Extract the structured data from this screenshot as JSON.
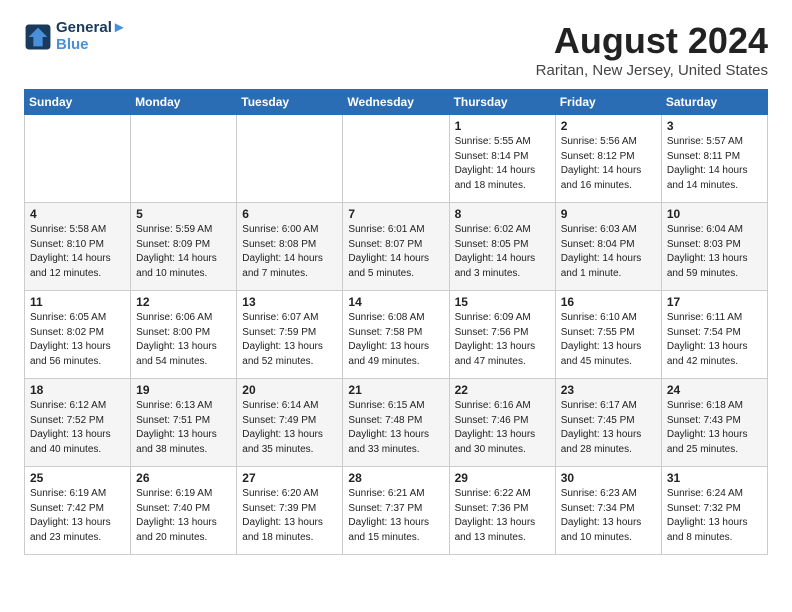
{
  "header": {
    "logo_line1": "General",
    "logo_line2": "Blue",
    "month": "August 2024",
    "location": "Raritan, New Jersey, United States"
  },
  "weekdays": [
    "Sunday",
    "Monday",
    "Tuesday",
    "Wednesday",
    "Thursday",
    "Friday",
    "Saturday"
  ],
  "weeks": [
    [
      {
        "day": "",
        "sunrise": "",
        "sunset": "",
        "daylight": ""
      },
      {
        "day": "",
        "sunrise": "",
        "sunset": "",
        "daylight": ""
      },
      {
        "day": "",
        "sunrise": "",
        "sunset": "",
        "daylight": ""
      },
      {
        "day": "",
        "sunrise": "",
        "sunset": "",
        "daylight": ""
      },
      {
        "day": "1",
        "sunrise": "Sunrise: 5:55 AM",
        "sunset": "Sunset: 8:14 PM",
        "daylight": "Daylight: 14 hours and 18 minutes."
      },
      {
        "day": "2",
        "sunrise": "Sunrise: 5:56 AM",
        "sunset": "Sunset: 8:12 PM",
        "daylight": "Daylight: 14 hours and 16 minutes."
      },
      {
        "day": "3",
        "sunrise": "Sunrise: 5:57 AM",
        "sunset": "Sunset: 8:11 PM",
        "daylight": "Daylight: 14 hours and 14 minutes."
      }
    ],
    [
      {
        "day": "4",
        "sunrise": "Sunrise: 5:58 AM",
        "sunset": "Sunset: 8:10 PM",
        "daylight": "Daylight: 14 hours and 12 minutes."
      },
      {
        "day": "5",
        "sunrise": "Sunrise: 5:59 AM",
        "sunset": "Sunset: 8:09 PM",
        "daylight": "Daylight: 14 hours and 10 minutes."
      },
      {
        "day": "6",
        "sunrise": "Sunrise: 6:00 AM",
        "sunset": "Sunset: 8:08 PM",
        "daylight": "Daylight: 14 hours and 7 minutes."
      },
      {
        "day": "7",
        "sunrise": "Sunrise: 6:01 AM",
        "sunset": "Sunset: 8:07 PM",
        "daylight": "Daylight: 14 hours and 5 minutes."
      },
      {
        "day": "8",
        "sunrise": "Sunrise: 6:02 AM",
        "sunset": "Sunset: 8:05 PM",
        "daylight": "Daylight: 14 hours and 3 minutes."
      },
      {
        "day": "9",
        "sunrise": "Sunrise: 6:03 AM",
        "sunset": "Sunset: 8:04 PM",
        "daylight": "Daylight: 14 hours and 1 minute."
      },
      {
        "day": "10",
        "sunrise": "Sunrise: 6:04 AM",
        "sunset": "Sunset: 8:03 PM",
        "daylight": "Daylight: 13 hours and 59 minutes."
      }
    ],
    [
      {
        "day": "11",
        "sunrise": "Sunrise: 6:05 AM",
        "sunset": "Sunset: 8:02 PM",
        "daylight": "Daylight: 13 hours and 56 minutes."
      },
      {
        "day": "12",
        "sunrise": "Sunrise: 6:06 AM",
        "sunset": "Sunset: 8:00 PM",
        "daylight": "Daylight: 13 hours and 54 minutes."
      },
      {
        "day": "13",
        "sunrise": "Sunrise: 6:07 AM",
        "sunset": "Sunset: 7:59 PM",
        "daylight": "Daylight: 13 hours and 52 minutes."
      },
      {
        "day": "14",
        "sunrise": "Sunrise: 6:08 AM",
        "sunset": "Sunset: 7:58 PM",
        "daylight": "Daylight: 13 hours and 49 minutes."
      },
      {
        "day": "15",
        "sunrise": "Sunrise: 6:09 AM",
        "sunset": "Sunset: 7:56 PM",
        "daylight": "Daylight: 13 hours and 47 minutes."
      },
      {
        "day": "16",
        "sunrise": "Sunrise: 6:10 AM",
        "sunset": "Sunset: 7:55 PM",
        "daylight": "Daylight: 13 hours and 45 minutes."
      },
      {
        "day": "17",
        "sunrise": "Sunrise: 6:11 AM",
        "sunset": "Sunset: 7:54 PM",
        "daylight": "Daylight: 13 hours and 42 minutes."
      }
    ],
    [
      {
        "day": "18",
        "sunrise": "Sunrise: 6:12 AM",
        "sunset": "Sunset: 7:52 PM",
        "daylight": "Daylight: 13 hours and 40 minutes."
      },
      {
        "day": "19",
        "sunrise": "Sunrise: 6:13 AM",
        "sunset": "Sunset: 7:51 PM",
        "daylight": "Daylight: 13 hours and 38 minutes."
      },
      {
        "day": "20",
        "sunrise": "Sunrise: 6:14 AM",
        "sunset": "Sunset: 7:49 PM",
        "daylight": "Daylight: 13 hours and 35 minutes."
      },
      {
        "day": "21",
        "sunrise": "Sunrise: 6:15 AM",
        "sunset": "Sunset: 7:48 PM",
        "daylight": "Daylight: 13 hours and 33 minutes."
      },
      {
        "day": "22",
        "sunrise": "Sunrise: 6:16 AM",
        "sunset": "Sunset: 7:46 PM",
        "daylight": "Daylight: 13 hours and 30 minutes."
      },
      {
        "day": "23",
        "sunrise": "Sunrise: 6:17 AM",
        "sunset": "Sunset: 7:45 PM",
        "daylight": "Daylight: 13 hours and 28 minutes."
      },
      {
        "day": "24",
        "sunrise": "Sunrise: 6:18 AM",
        "sunset": "Sunset: 7:43 PM",
        "daylight": "Daylight: 13 hours and 25 minutes."
      }
    ],
    [
      {
        "day": "25",
        "sunrise": "Sunrise: 6:19 AM",
        "sunset": "Sunset: 7:42 PM",
        "daylight": "Daylight: 13 hours and 23 minutes."
      },
      {
        "day": "26",
        "sunrise": "Sunrise: 6:19 AM",
        "sunset": "Sunset: 7:40 PM",
        "daylight": "Daylight: 13 hours and 20 minutes."
      },
      {
        "day": "27",
        "sunrise": "Sunrise: 6:20 AM",
        "sunset": "Sunset: 7:39 PM",
        "daylight": "Daylight: 13 hours and 18 minutes."
      },
      {
        "day": "28",
        "sunrise": "Sunrise: 6:21 AM",
        "sunset": "Sunset: 7:37 PM",
        "daylight": "Daylight: 13 hours and 15 minutes."
      },
      {
        "day": "29",
        "sunrise": "Sunrise: 6:22 AM",
        "sunset": "Sunset: 7:36 PM",
        "daylight": "Daylight: 13 hours and 13 minutes."
      },
      {
        "day": "30",
        "sunrise": "Sunrise: 6:23 AM",
        "sunset": "Sunset: 7:34 PM",
        "daylight": "Daylight: 13 hours and 10 minutes."
      },
      {
        "day": "31",
        "sunrise": "Sunrise: 6:24 AM",
        "sunset": "Sunset: 7:32 PM",
        "daylight": "Daylight: 13 hours and 8 minutes."
      }
    ]
  ]
}
